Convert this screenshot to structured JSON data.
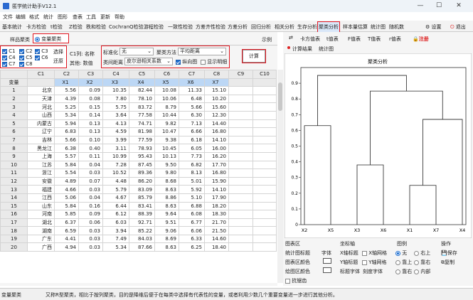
{
  "window": {
    "title": "匿学统计助手V12.1",
    "minimize": "—",
    "maximize": "☐",
    "close": "✕"
  },
  "menu": [
    "文件",
    "编辑",
    "格式",
    "统计",
    "图形",
    "查表",
    "工具",
    "更新",
    "帮助"
  ],
  "toolbar": {
    "items": [
      "基本统计",
      "卡方检验",
      "t检验",
      "Z检验",
      "秩和检验",
      "CochranQ检验",
      "游程检验",
      "一致性检验",
      "方差齐性检验",
      "方差分析",
      "回归分析",
      "相关分析",
      "生存分析",
      "聚类分析",
      "样本量估算",
      "统计图",
      "随机数"
    ],
    "settings": "设置",
    "exit": "退出"
  },
  "left": {
    "tab_sample": "样品聚类",
    "tab_variable": "变量聚类",
    "example": "示例",
    "var_checks": [
      "C1",
      "C2",
      "C3",
      "C4",
      "C5",
      "C6",
      "C7",
      "C8"
    ],
    "select_btn": "选择",
    "restore_btn": "还原",
    "name_label": "C1列: 名称",
    "other_label": "其他: 数值",
    "standardize_label": "标准化",
    "standardize_value": "无",
    "method_label": "聚类方法",
    "method_value": "平均距离",
    "distance_label": "类间距离",
    "distance_value": "皮尔逊相关系数",
    "vertical_label": "纵向图",
    "show_detail_label": "显示明细",
    "compute_btn": "计算"
  },
  "grid": {
    "col_headers": [
      "C1",
      "C2",
      "C3",
      "C4",
      "C5",
      "C6",
      "C7",
      "C8",
      "C9",
      "C10"
    ],
    "var_row": [
      "变量",
      "",
      "X1",
      "X2",
      "X3",
      "X4",
      "X5",
      "X6",
      "X7"
    ],
    "rows": [
      [
        "1",
        "北京",
        "5.56",
        "0.09",
        "10.35",
        "82.44",
        "10.08",
        "11.33",
        "15.10"
      ],
      [
        "2",
        "天津",
        "4.39",
        "0.08",
        "7.80",
        "78.10",
        "10.06",
        "6.48",
        "10.20"
      ],
      [
        "3",
        "河北",
        "5.25",
        "0.15",
        "5.75",
        "83.72",
        "8.79",
        "5.66",
        "15.60"
      ],
      [
        "4",
        "山西",
        "5.34",
        "0.14",
        "3.64",
        "77.58",
        "10.44",
        "6.30",
        "12.30"
      ],
      [
        "5",
        "内蒙古",
        "5.94",
        "0.13",
        "4.13",
        "74.71",
        "9.82",
        "7.13",
        "14.40"
      ],
      [
        "6",
        "辽宁",
        "6.83",
        "0.13",
        "4.59",
        "81.98",
        "10.47",
        "6.66",
        "16.80"
      ],
      [
        "7",
        "吉林",
        "5.66",
        "0.10",
        "3.99",
        "77.59",
        "9.38",
        "6.18",
        "14.10"
      ],
      [
        "8",
        "黑龙江",
        "6.38",
        "0.40",
        "3.11",
        "78.93",
        "10.45",
        "6.05",
        "16.00"
      ],
      [
        "9",
        "上海",
        "5.57",
        "0.11",
        "10.99",
        "95.43",
        "10.13",
        "7.73",
        "16.20"
      ],
      [
        "10",
        "江苏",
        "5.84",
        "0.04",
        "7.28",
        "87.45",
        "9.50",
        "6.82",
        "17.70"
      ],
      [
        "11",
        "浙江",
        "5.54",
        "0.03",
        "10.52",
        "89.36",
        "9.80",
        "8.13",
        "16.80"
      ],
      [
        "12",
        "安徽",
        "4.89",
        "0.07",
        "4.48",
        "86.20",
        "8.68",
        "5.01",
        "15.90"
      ],
      [
        "13",
        "福建",
        "4.66",
        "0.03",
        "5.79",
        "83.09",
        "8.63",
        "5.92",
        "14.10"
      ],
      [
        "14",
        "江西",
        "5.06",
        "0.04",
        "4.67",
        "85.79",
        "8.86",
        "5.10",
        "17.90"
      ],
      [
        "15",
        "山东",
        "5.84",
        "0.16",
        "6.44",
        "83.41",
        "8.63",
        "6.88",
        "18.20"
      ],
      [
        "16",
        "河南",
        "5.85",
        "0.09",
        "6.12",
        "88.39",
        "9.64",
        "6.08",
        "18.30"
      ],
      [
        "17",
        "湖北",
        "6.37",
        "0.06",
        "6.03",
        "92.71",
        "9.51",
        "6.77",
        "21.70"
      ],
      [
        "18",
        "湖南",
        "6.59",
        "0.03",
        "3.94",
        "85.22",
        "9.06",
        "6.06",
        "21.50"
      ],
      [
        "19",
        "广东",
        "4.41",
        "0.03",
        "7.49",
        "84.03",
        "8.69",
        "6.33",
        "14.60"
      ],
      [
        "20",
        "广西",
        "4.94",
        "0.03",
        "5.34",
        "87.66",
        "8.63",
        "6.25",
        "18.40"
      ]
    ]
  },
  "right": {
    "tabs": [
      "卡方值表",
      "t值表",
      "F值表",
      "T值表",
      "r值表"
    ],
    "register": "注册",
    "result_tabs": [
      "计算结果",
      "统计图"
    ],
    "chart_title": "聚类分析",
    "area_label": "图表区",
    "chart_title_label": "统计图标题",
    "font_label": "字体",
    "chart_bg_label": "图表区颜色",
    "plot_bg_label": "绘图区颜色",
    "antialias_label": "抗锯齿",
    "axis_label": "坐标轴",
    "x_title_label": "X轴标题",
    "x_grid_label": "X轴网格",
    "y_title_label": "Y轴标题",
    "y_grid_label": "Y轴网格",
    "title_font_label": "标题字体",
    "tick_font_label": "刻度字体",
    "legend_label": "图例",
    "legend_none": "无",
    "legend_top_right": "右上",
    "legend_top_left": "靠上",
    "legend_right": "靠右",
    "legend_bottom": "靠右",
    "legend_inside": "内部",
    "ops_label": "操作",
    "save_label": "保存",
    "copy_label": "复制"
  },
  "chart_data": {
    "type": "dendrogram",
    "title": "聚类分析",
    "leaves": [
      "X2",
      "X5",
      "X3",
      "X6",
      "X1",
      "X7",
      "X4"
    ],
    "ylim": [
      0,
      1.0
    ],
    "yticks": [
      0,
      0.1,
      0.2,
      0.3,
      0.4,
      0.5,
      0.6,
      0.7,
      0.8,
      0.9
    ],
    "merges": [
      {
        "left": "X1",
        "right": "X7",
        "height": 0.25
      },
      {
        "left": "X3",
        "right": "X6",
        "height": 0.38
      },
      {
        "left": "X1+X7",
        "right": "X4",
        "height": 0.67
      },
      {
        "left": "X2",
        "right": "X5",
        "height": 0.63
      },
      {
        "left": "X3+X6",
        "right": "X1+X7+X4",
        "height": 0.85
      },
      {
        "left": "X2+X5",
        "right": "rest",
        "height": 0.95
      }
    ]
  },
  "status": {
    "left": "变量聚类",
    "text": "又称R型聚类，相比于按列聚类，目的是降维后便于在每类中选择有代表性的变量，或者利用少数几个重要变量进一步进行其他分析。"
  }
}
